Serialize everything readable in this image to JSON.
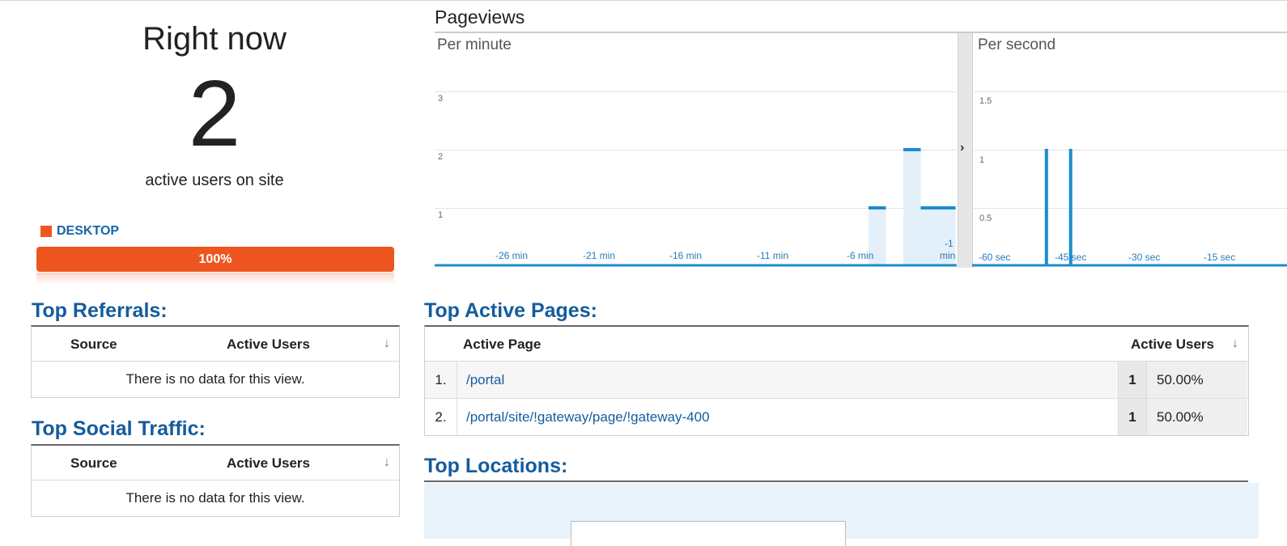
{
  "right_now": {
    "title": "Right now",
    "count": "2",
    "subtitle": "active users on site",
    "device_label": "DESKTOP",
    "device_pct": "100%",
    "device_color": "#ee561f"
  },
  "pageviews": {
    "title": "Pageviews",
    "per_minute": {
      "label": "Per minute",
      "y_ticks": [
        "3",
        "2",
        "1"
      ],
      "x_ticks": [
        "-26 min",
        "-21 min",
        "-16 min",
        "-11 min",
        "-6 min",
        "-1",
        "min"
      ]
    },
    "per_second": {
      "label": "Per second",
      "y_ticks": [
        "1.5",
        "1",
        "0.5"
      ],
      "x_ticks": [
        "-60 sec",
        "-45 sec",
        "-30 sec",
        "-15 sec"
      ]
    },
    "expand_icon": "chevron-right-icon"
  },
  "chart_data": [
    {
      "type": "bar",
      "categories": [
        "-6 min",
        "-5 min",
        "-4 min",
        "-3 min",
        "-2 min"
      ],
      "values": [
        1,
        0,
        2,
        1,
        1
      ],
      "ylim": [
        0,
        3
      ]
    },
    {
      "type": "bar",
      "x_label_points": [
        "-60 sec",
        "-45 sec",
        "-30 sec",
        "-15 sec"
      ],
      "values_at_sec": [
        {
          "sec": -46,
          "value": 1
        },
        {
          "sec": -41,
          "value": 1
        }
      ],
      "ylim": [
        0,
        1.5
      ]
    }
  ],
  "top_referrals": {
    "title": "Top Referrals:",
    "col_source": "Source",
    "col_users": "Active Users",
    "sort_icon": "arrow-down-icon",
    "empty": "There is no data for this view."
  },
  "top_social": {
    "title": "Top Social Traffic:",
    "col_source": "Source",
    "col_users": "Active Users",
    "sort_icon": "arrow-down-icon",
    "empty": "There is no data for this view."
  },
  "top_pages": {
    "title": "Top Active Pages:",
    "col_page": "Active Page",
    "col_users": "Active Users",
    "rows": [
      {
        "num": "1.",
        "page": "/portal",
        "count": "1",
        "pct": "50.00%"
      },
      {
        "num": "2.",
        "page": "/portal/site/!gateway/page/!gateway-400",
        "count": "1",
        "pct": "50.00%"
      }
    ]
  },
  "top_locations": {
    "title": "Top Locations:"
  }
}
